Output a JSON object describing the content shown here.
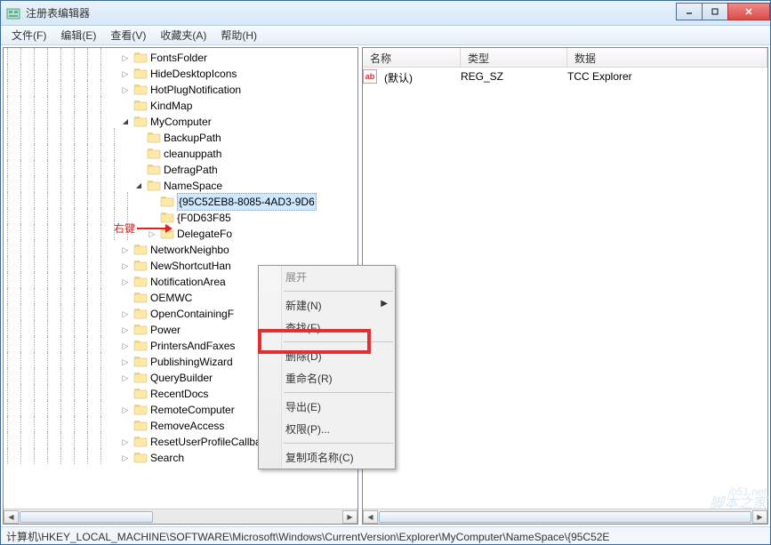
{
  "window": {
    "title": "注册表编辑器"
  },
  "menu": {
    "file": "文件(F)",
    "edit": "编辑(E)",
    "view": "查看(V)",
    "fav": "收藏夹(A)",
    "help": "帮助(H)"
  },
  "annotation": {
    "label": "右键"
  },
  "tree": {
    "nodes": [
      {
        "indent": 8,
        "toggle": "closed",
        "label": "FontsFolder"
      },
      {
        "indent": 8,
        "toggle": "closed",
        "label": "HideDesktopIcons"
      },
      {
        "indent": 8,
        "toggle": "closed",
        "label": "HotPlugNotification"
      },
      {
        "indent": 8,
        "toggle": "leaf",
        "label": "KindMap"
      },
      {
        "indent": 8,
        "toggle": "open",
        "label": "MyComputer"
      },
      {
        "indent": 9,
        "toggle": "leaf",
        "label": "BackupPath"
      },
      {
        "indent": 9,
        "toggle": "leaf",
        "label": "cleanuppath"
      },
      {
        "indent": 9,
        "toggle": "leaf",
        "label": "DefragPath"
      },
      {
        "indent": 9,
        "toggle": "open",
        "label": "NameSpace"
      },
      {
        "indent": 10,
        "toggle": "leaf",
        "label": "{95C52EB8-8085-4AD3-9D6",
        "selected": true
      },
      {
        "indent": 10,
        "toggle": "leaf",
        "label": "{F0D63F85"
      },
      {
        "indent": 10,
        "toggle": "closed",
        "label": "DelegateFo"
      },
      {
        "indent": 8,
        "toggle": "closed",
        "label": "NetworkNeighbo"
      },
      {
        "indent": 8,
        "toggle": "closed",
        "label": "NewShortcutHan"
      },
      {
        "indent": 8,
        "toggle": "closed",
        "label": "NotificationArea"
      },
      {
        "indent": 8,
        "toggle": "leaf",
        "label": "OEMWC"
      },
      {
        "indent": 8,
        "toggle": "closed",
        "label": "OpenContainingF"
      },
      {
        "indent": 8,
        "toggle": "closed",
        "label": "Power"
      },
      {
        "indent": 8,
        "toggle": "closed",
        "label": "PrintersAndFaxes"
      },
      {
        "indent": 8,
        "toggle": "closed",
        "label": "PublishingWizard"
      },
      {
        "indent": 8,
        "toggle": "closed",
        "label": "QueryBuilder"
      },
      {
        "indent": 8,
        "toggle": "leaf",
        "label": "RecentDocs"
      },
      {
        "indent": 8,
        "toggle": "closed",
        "label": "RemoteComputer"
      },
      {
        "indent": 8,
        "toggle": "leaf",
        "label": "RemoveAccess"
      },
      {
        "indent": 8,
        "toggle": "closed",
        "label": "ResetUserProfileCallbacks"
      },
      {
        "indent": 8,
        "toggle": "closed",
        "label": "Search"
      }
    ]
  },
  "list": {
    "columns": {
      "name": "名称",
      "type": "类型",
      "data": "数据"
    },
    "rows": [
      {
        "name": "(默认)",
        "type": "REG_SZ",
        "data": "TCC Explorer"
      }
    ]
  },
  "context_menu": {
    "expand": "展开",
    "new": "新建(N)",
    "find": "查找(F)...",
    "delete": "删除(D)",
    "rename": "重命名(R)",
    "export": "导出(E)",
    "perm": "权限(P)...",
    "copykey": "复制项名称(C)"
  },
  "statusbar": {
    "path": "计算机\\HKEY_LOCAL_MACHINE\\SOFTWARE\\Microsoft\\Windows\\CurrentVersion\\Explorer\\MyComputer\\NameSpace\\{95C52E"
  },
  "watermark": {
    "line1": "jb51.net",
    "line2": "脚本之家"
  }
}
